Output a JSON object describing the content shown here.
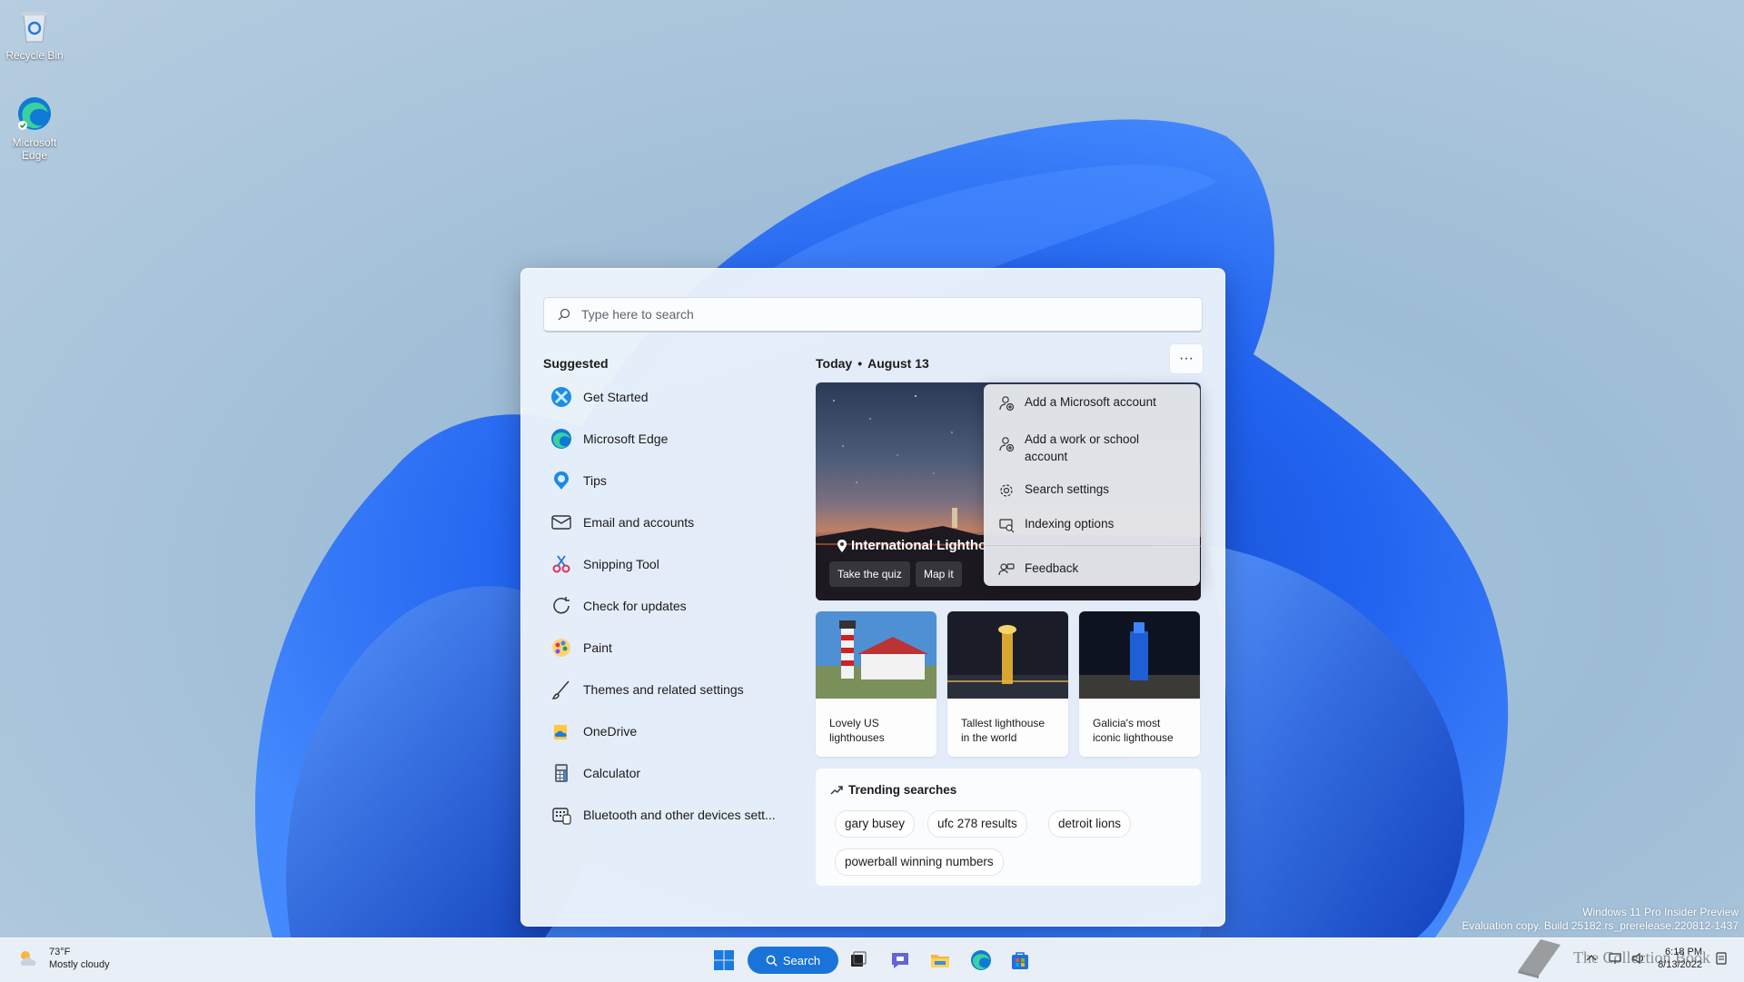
{
  "desktop": {
    "icons": [
      {
        "label": "Recycle Bin",
        "icon": "recycle-bin-icon"
      },
      {
        "label": "Microsoft Edge",
        "icon": "edge-icon"
      }
    ]
  },
  "flyout": {
    "search": {
      "placeholder": "Type here to search",
      "value": ""
    },
    "suggested_title": "Suggested",
    "suggested": [
      {
        "label": "Get Started",
        "icon": "get-started-icon"
      },
      {
        "label": "Microsoft Edge",
        "icon": "edge-icon"
      },
      {
        "label": "Tips",
        "icon": "tips-icon"
      },
      {
        "label": "Email and accounts",
        "icon": "mail-icon"
      },
      {
        "label": "Snipping Tool",
        "icon": "snipping-tool-icon"
      },
      {
        "label": "Check for updates",
        "icon": "refresh-icon"
      },
      {
        "label": "Paint",
        "icon": "paint-icon"
      },
      {
        "label": "Themes and related settings",
        "icon": "brush-icon"
      },
      {
        "label": "OneDrive",
        "icon": "onedrive-icon"
      },
      {
        "label": "Calculator",
        "icon": "calculator-icon"
      },
      {
        "label": "Bluetooth and other devices sett...",
        "icon": "bluetooth-devices-icon"
      }
    ],
    "today": {
      "label": "Today",
      "date": "August 13",
      "more": "···"
    },
    "hero": {
      "title": "International Lightho",
      "buttons": [
        "Take the quiz",
        "Map it"
      ]
    },
    "context_menu": [
      {
        "label": "Add a Microsoft account",
        "icon": "person-add-icon"
      },
      {
        "label": "Add a work or school account",
        "icon": "person-add-icon"
      },
      {
        "label": "Search settings",
        "icon": "gear-icon"
      },
      {
        "label": "Indexing options",
        "icon": "indexing-icon"
      },
      {
        "label": "Feedback",
        "icon": "feedback-icon"
      }
    ],
    "cards": [
      {
        "caption": "Lovely US lighthouses"
      },
      {
        "caption": "Tallest lighthouse in the world"
      },
      {
        "caption": "Galicia's most iconic lighthouse"
      }
    ],
    "trending": {
      "title": "Trending searches",
      "chips": [
        "gary busey",
        "ufc 278 results",
        "detroit lions",
        "powerball winning numbers"
      ]
    }
  },
  "taskbar": {
    "weather": {
      "temp": "73°F",
      "condition": "Mostly cloudy"
    },
    "search_label": "Search",
    "clock": {
      "time": "6:18 PM",
      "date": "8/13/2022"
    }
  },
  "watermark": {
    "line1": "Windows 11 Pro Insider Preview",
    "line2": "Evaluation copy. Build 25182.rs_prerelease.220812-1437"
  },
  "brand_overlay": "The Collection Book",
  "colors": {
    "accent": "#1a73d9",
    "bloom": "#1d63e6"
  }
}
